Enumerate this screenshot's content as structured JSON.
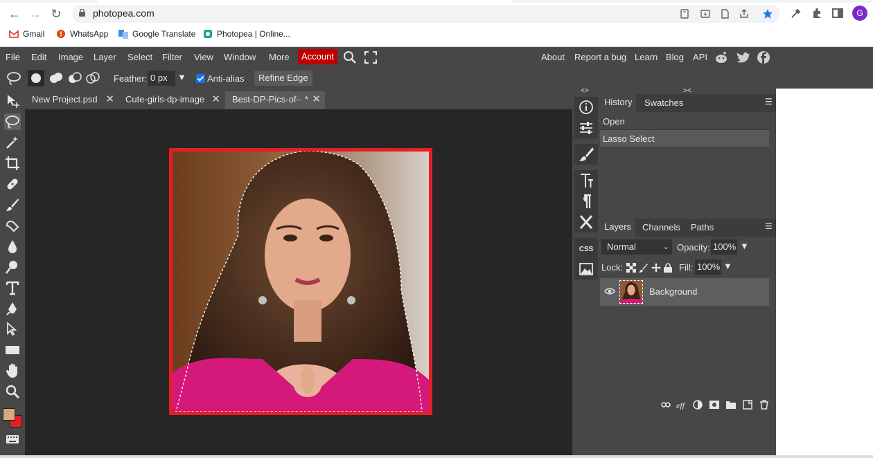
{
  "browser": {
    "url": "photopea.com",
    "profile_initial": "G",
    "bookmarks": [
      {
        "label": "Gmail"
      },
      {
        "label": "WhatsApp"
      },
      {
        "label": "Google Translate"
      },
      {
        "label": "Photopea | Online..."
      }
    ]
  },
  "menubar": {
    "items": [
      "File",
      "Edit",
      "Image",
      "Layer",
      "Select",
      "Filter",
      "View",
      "Window",
      "More"
    ],
    "account_label": "Account",
    "right_items": [
      "About",
      "Report a bug",
      "Learn",
      "Blog",
      "API"
    ]
  },
  "options": {
    "feather_label": "Feather:",
    "feather_value": "0 px",
    "antialias_label": "Anti-alias",
    "refine_label": "Refine Edge"
  },
  "doc_tabs": [
    {
      "label": "New Project.psd"
    },
    {
      "label": "Cute-girls-dp-image"
    },
    {
      "label": "Best-DP-Pics-of-· *"
    }
  ],
  "history": {
    "tabs": [
      "History",
      "Swatches"
    ],
    "rows": [
      "Open",
      "Lasso Select"
    ]
  },
  "layers": {
    "tabs": [
      "Layers",
      "Channels",
      "Paths"
    ],
    "blend_mode": "Normal",
    "opacity_label": "Opacity:",
    "opacity_value": "100%",
    "lock_label": "Lock:",
    "fill_label": "Fill:",
    "fill_value": "100%",
    "layer_name": "Background"
  },
  "colors": {
    "foreground": "#d9a77e",
    "background": "#e41e26",
    "account": "#c00000"
  }
}
